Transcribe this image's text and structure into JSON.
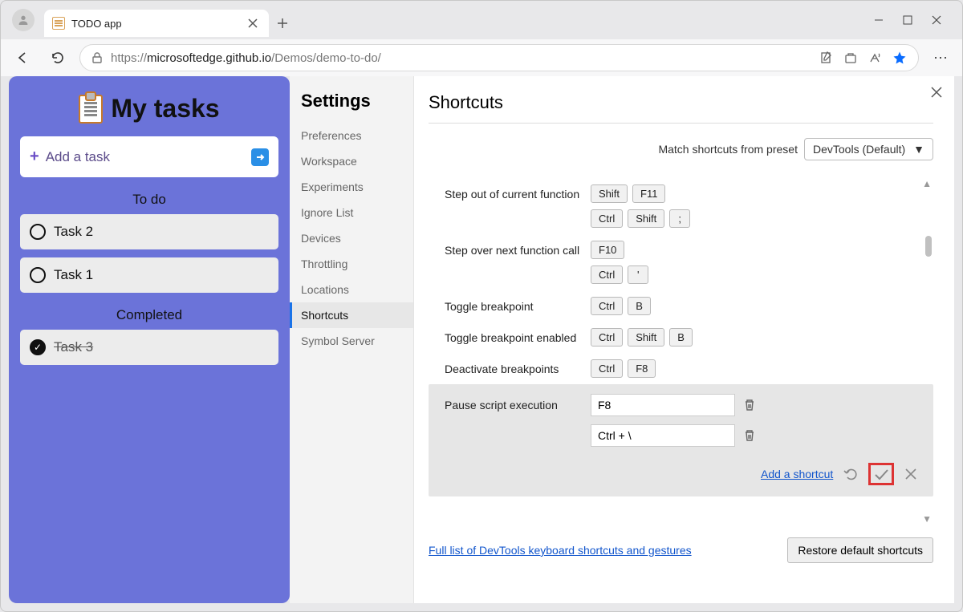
{
  "browser": {
    "tab_title": "TODO app",
    "url_prefix": "https://",
    "url_host": "microsoftedge.github.io",
    "url_path": "/Demos/demo-to-do/"
  },
  "app": {
    "title": "My tasks",
    "add_placeholder": "Add a task",
    "sections": {
      "todo": "To do",
      "done": "Completed"
    },
    "tasks_todo": [
      "Task 2",
      "Task 1"
    ],
    "tasks_done": [
      "Task 3"
    ]
  },
  "settings": {
    "nav_title": "Settings",
    "items": [
      "Preferences",
      "Workspace",
      "Experiments",
      "Ignore List",
      "Devices",
      "Throttling",
      "Locations",
      "Shortcuts",
      "Symbol Server"
    ],
    "active_index": 7
  },
  "panel": {
    "title": "Shortcuts",
    "preset_label": "Match shortcuts from preset",
    "preset_value": "DevTools (Default)",
    "rows": [
      {
        "label": "Step out of current function",
        "keys": [
          [
            "Shift",
            "F11"
          ],
          [
            "Ctrl",
            "Shift",
            ";"
          ]
        ]
      },
      {
        "label": "Step over next function call",
        "keys": [
          [
            "F10"
          ],
          [
            "Ctrl",
            "'"
          ]
        ]
      },
      {
        "label": "Toggle breakpoint",
        "keys": [
          [
            "Ctrl",
            "B"
          ]
        ]
      },
      {
        "label": "Toggle breakpoint enabled",
        "keys": [
          [
            "Ctrl",
            "Shift",
            "B"
          ]
        ]
      },
      {
        "label": "Deactivate breakpoints",
        "keys": [
          [
            "Ctrl",
            "F8"
          ]
        ]
      }
    ],
    "editing": {
      "label": "Pause script execution",
      "values": [
        "F8",
        "Ctrl + \\"
      ],
      "add_link": "Add a shortcut"
    },
    "footer_link": "Full list of DevTools keyboard shortcuts and gestures",
    "restore_btn": "Restore default shortcuts"
  }
}
